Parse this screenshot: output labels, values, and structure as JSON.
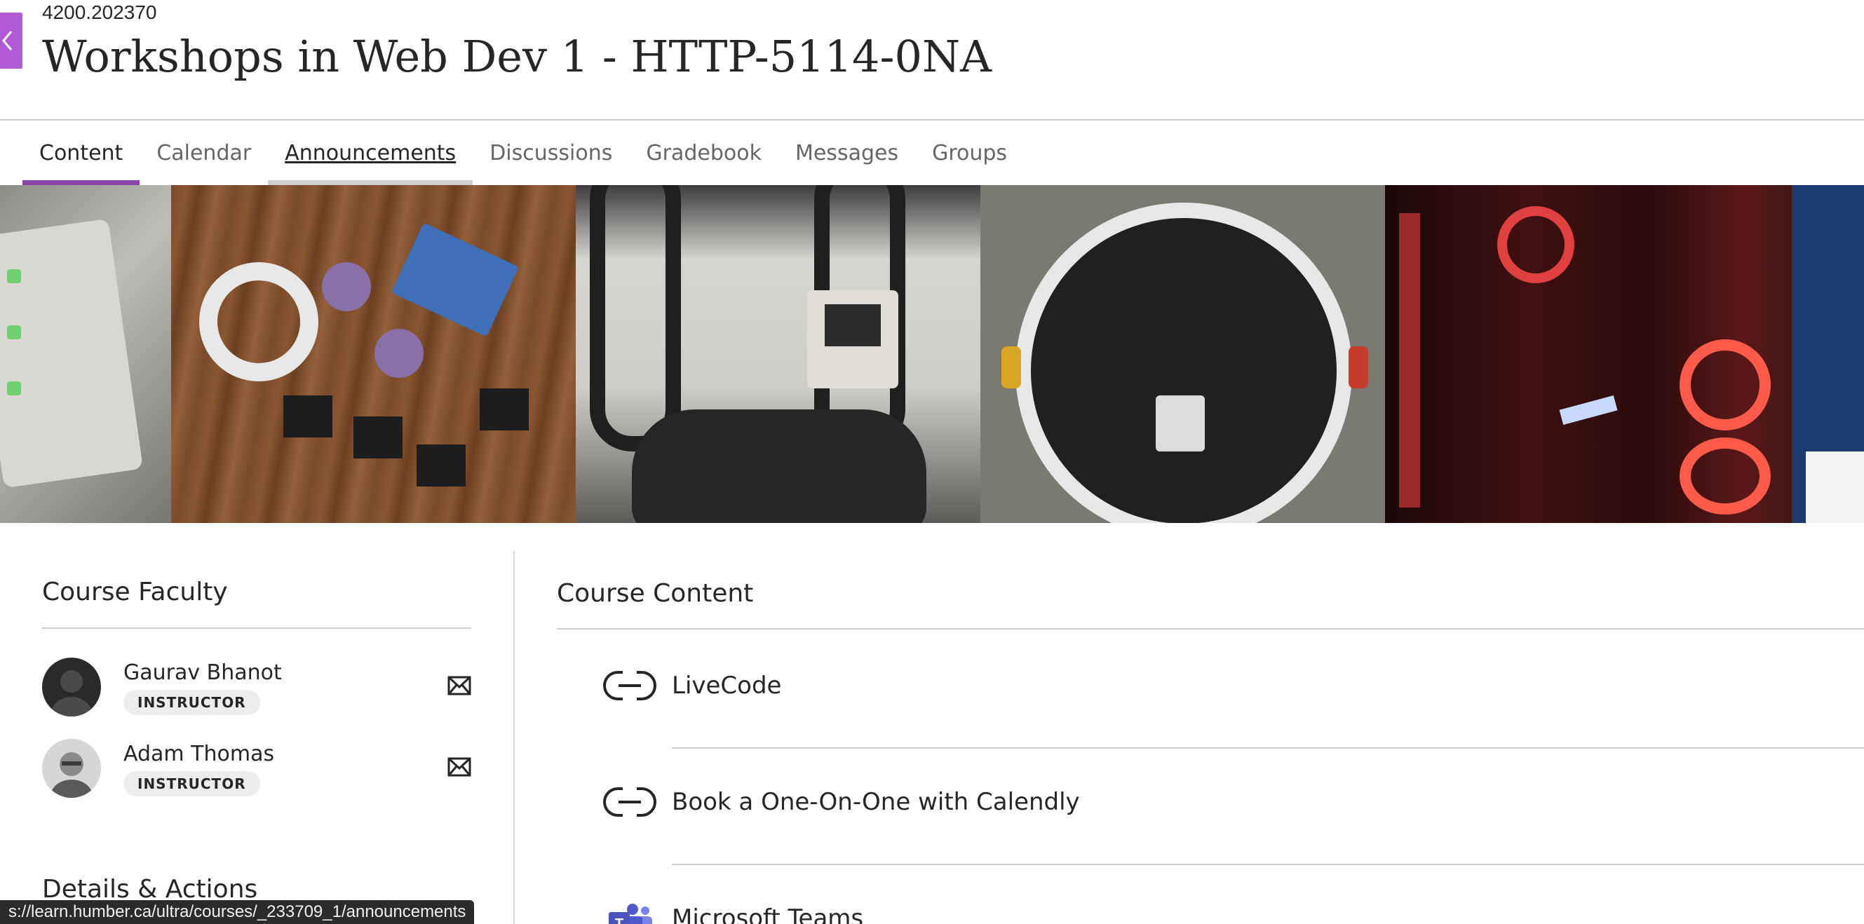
{
  "header": {
    "course_id": "4200.202370",
    "course_title": "Workshops in Web Dev 1 - HTTP-5114-0NA",
    "accent_color": "#b25ad6"
  },
  "tabs": [
    {
      "label": "Content",
      "active": true
    },
    {
      "label": "Calendar"
    },
    {
      "label": "Announcements",
      "hovered": true
    },
    {
      "label": "Discussions"
    },
    {
      "label": "Gradebook"
    },
    {
      "label": "Messages"
    },
    {
      "label": "Groups"
    }
  ],
  "faculty": {
    "title": "Course Faculty",
    "members": [
      {
        "name": "Gaurav Bhanot",
        "role": "INSTRUCTOR"
      },
      {
        "name": "Adam Thomas",
        "role": "INSTRUCTOR"
      }
    ]
  },
  "details": {
    "title": "Details & Actions"
  },
  "content": {
    "title": "Course Content",
    "items": [
      {
        "label": "LiveCode",
        "icon": "link-icon"
      },
      {
        "label": "Book a One-On-One with Calendly",
        "icon": "link-icon"
      },
      {
        "label": "Microsoft Teams",
        "icon": "teams-icon"
      }
    ]
  },
  "status_bar": {
    "url": "s://learn.humber.ca/ultra/courses/_233709_1/announcements"
  }
}
